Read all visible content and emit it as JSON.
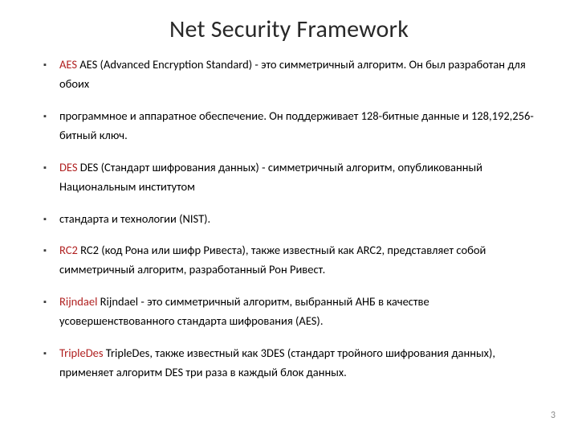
{
  "title": "Net Security Framework",
  "bullets": [
    {
      "term": "AES",
      "rest": " AES (Advanced Encryption Standard) - это симметричный алгоритм. Он был разработан для обоих"
    },
    {
      "term": "",
      "rest": "программное и аппаратное обеспечение. Он поддерживает 128-битные данные и 128,192,256-битный ключ."
    },
    {
      "term": "DES",
      "rest": " DES (Стандарт шифрования данных) - симметричный алгоритм, опубликованный Национальным институтом"
    },
    {
      "term": "",
      "rest": "стандарта и технологии (NIST)."
    },
    {
      "term": "RC2",
      "rest": " RC2 (код Рона или шифр Ривеста), также известный как ARC2, представляет собой симметричный алгоритм, разработанный Рон Ривест."
    },
    {
      "term": "Rijndael",
      "rest": " Rijndael - это симметричный алгоритм, выбранный АНБ в качестве усовершенствованного стандарта шифрования (AES)."
    },
    {
      "term": "TripleDes",
      "rest": " TripleDes, также известный как 3DES (стандарт тройного шифрования данных), применяет алгоритм DES три раза в каждый блок данных."
    }
  ],
  "page_number": "3"
}
